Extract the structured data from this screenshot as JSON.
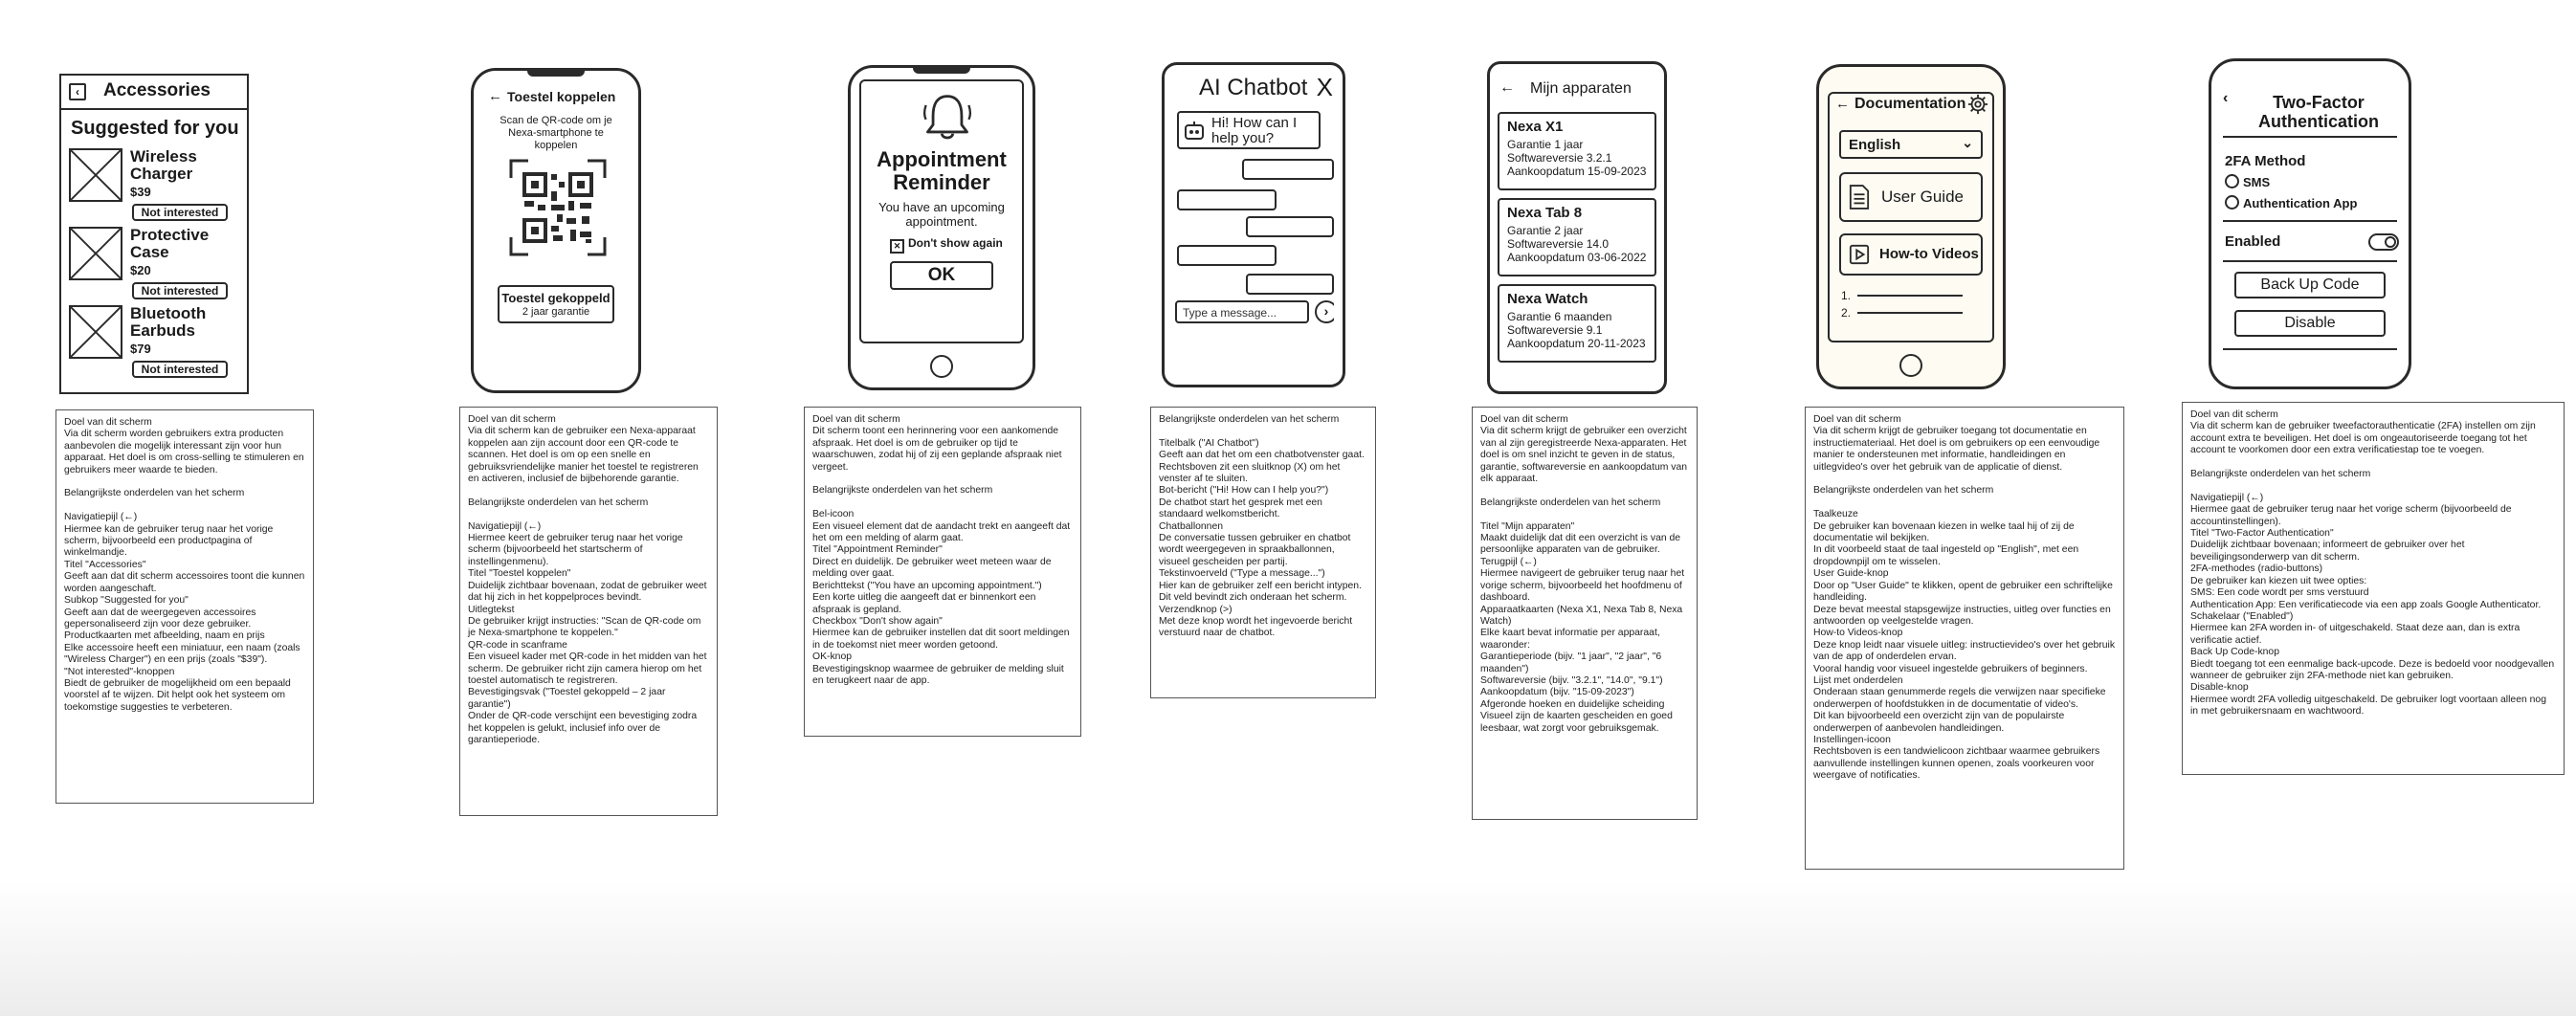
{
  "accessories": {
    "title": "Accessories",
    "subtitle": "Suggested for you",
    "not_interested": "Not interested",
    "products": [
      {
        "name1": "Wireless",
        "name2": "Charger",
        "price": "$39"
      },
      {
        "name1": "Protective",
        "name2": "Case",
        "price": "$20"
      },
      {
        "name1": "Bluetooth",
        "name2": "Earbuds",
        "price": "$79"
      }
    ],
    "desc": "Doel van dit scherm\nVia dit scherm worden gebruikers extra producten aanbevolen die mogelijk interessant zijn voor hun apparaat. Het doel is om cross-selling te stimuleren en gebruikers meer waarde te bieden.\n\nBelangrijkste onderdelen van het scherm\n\nNavigatiepijl (←)\nHiermee kan de gebruiker terug naar het vorige scherm, bijvoorbeeld een productpagina of winkelmandje.\nTitel \"Accessories\"\nGeeft aan dat dit scherm accessoires toont die kunnen worden aangeschaft.\nSubkop \"Suggested for you\"\nGeeft aan dat de weergegeven accessoires gepersonaliseerd zijn voor deze gebruiker.\nProductkaarten met afbeelding, naam en prijs\nElke accessoire heeft een miniatuur, een naam (zoals \"Wireless Charger\") en een prijs (zoals \"$39\").\n\"Not interested\"-knoppen\nBiedt de gebruiker de mogelijkheid om een bepaald voorstel af te wijzen. Dit helpt ook het systeem om toekomstige suggesties te verbeteren."
  },
  "pair": {
    "title": "Toestel koppelen",
    "instruction": "Scan de QR-code om je Nexa-smartphone te koppelen",
    "status_title": "Toestel gekoppeld",
    "status_sub": "2 jaar garantie",
    "desc": "Doel van dit scherm\nVia dit scherm kan de gebruiker een Nexa-apparaat koppelen aan zijn account door een QR-code te scannen. Het doel is om op een snelle en gebruiksvriendelijke manier het toestel te registreren en activeren, inclusief de bijbehorende garantie.\n\nBelangrijkste onderdelen van het scherm\n\nNavigatiepijl (←)\nHiermee keert de gebruiker terug naar het vorige scherm (bijvoorbeeld het startscherm of instellingenmenu).\nTitel \"Toestel koppelen\"\nDuidelijk zichtbaar bovenaan, zodat de gebruiker weet dat hij zich in het koppelproces bevindt.\nUitlegtekst\nDe gebruiker krijgt instructies: \"Scan de QR-code om je Nexa-smartphone te koppelen.\"\nQR-code in scanframe\nEen visueel kader met QR-code in het midden van het scherm. De gebruiker richt zijn camera hierop om het toestel automatisch te registreren.\nBevestigingsvak (\"Toestel gekoppeld – 2 jaar garantie\")\nOnder de QR-code verschijnt een bevestiging zodra het koppelen is gelukt, inclusief info over de garantieperiode."
  },
  "reminder": {
    "title1": "Appointment",
    "title2": "Reminder",
    "message": "You have an upcoming appointment.",
    "checkbox": "Don't show again",
    "ok": "OK",
    "desc": "Doel van dit scherm\nDit scherm toont een herinnering voor een aankomende afspraak. Het doel is om de gebruiker op tijd te waarschuwen, zodat hij of zij een geplande afspraak niet vergeet.\n\nBelangrijkste onderdelen van het scherm\n\nBel-icoon\nEen visueel element dat de aandacht trekt en aangeeft dat het om een melding of alarm gaat.\nTitel \"Appointment Reminder\"\nDirect en duidelijk. De gebruiker weet meteen waar de melding over gaat.\nBerichttekst (\"You have an upcoming appointment.\")\nEen korte uitleg die aangeeft dat er binnenkort een afspraak is gepland.\nCheckbox \"Don't show again\"\nHiermee kan de gebruiker instellen dat dit soort meldingen in de toekomst niet meer worden getoond.\nOK-knop\nBevestigingsknop waarmee de gebruiker de melding sluit en terugkeert naar de app."
  },
  "chatbot": {
    "title": "AI Chatbot",
    "close": "X",
    "greeting": "Hi! How can I help you?",
    "placeholder": "Type a message...",
    "desc": "Belangrijkste onderdelen van het scherm\n\nTitelbalk (\"AI Chatbot\")\nGeeft aan dat het om een chatbotvenster gaat. Rechtsboven zit een sluitknop (X) om het venster af te sluiten.\nBot-bericht (\"Hi! How can I help you?\")\nDe chatbot start het gesprek met een standaard welkomstbericht.\nChatballonnen\nDe conversatie tussen gebruiker en chatbot wordt weergegeven in spraakballonnen, visueel gescheiden per partij.\nTekstinvoerveld (\"Type a message...\")\nHier kan de gebruiker zelf een bericht intypen. Dit veld bevindt zich onderaan het scherm.\nVerzendknop (>)\nMet deze knop wordt het ingevoerde bericht verstuurd naar de chatbot."
  },
  "devices": {
    "title": "Mijn apparaten",
    "items": [
      {
        "name": "Nexa X1",
        "warranty": "Garantie 1 jaar",
        "software": "Softwareversie 3.2.1",
        "date": "Aankoopdatum 15-09-2023"
      },
      {
        "name": "Nexa Tab 8",
        "warranty": "Garantie 2 jaar",
        "software": "Softwareversie 14.0",
        "date": "Aankoopdatum 03-06-2022"
      },
      {
        "name": "Nexa Watch",
        "warranty": "Garantie 6 maanden",
        "software": "Softwareversie 9.1",
        "date": "Aankoopdatum 20-11-2023"
      }
    ],
    "desc": "Doel van dit scherm\nVia dit scherm krijgt de gebruiker een overzicht van al zijn geregistreerde Nexa-apparaten. Het doel is om snel inzicht te geven in de status, garantie, softwareversie en aankoopdatum van elk apparaat.\n\nBelangrijkste onderdelen van het scherm\n\nTitel \"Mijn apparaten\"\nMaakt duidelijk dat dit een overzicht is van de persoonlijke apparaten van de gebruiker.\nTerugpijl (←)\nHiermee navigeert de gebruiker terug naar het vorige scherm, bijvoorbeeld het hoofdmenu of dashboard.\nApparaatkaarten (Nexa X1, Nexa Tab 8, Nexa Watch)\nElke kaart bevat informatie per apparaat, waaronder:\nGarantieperiode (bijv. \"1 jaar\", \"2 jaar\", \"6 maanden\")\nSoftwareversie (bijv. \"3.2.1\", \"14.0\", \"9.1\")\nAankoopdatum (bijv. \"15-09-2023\")\nAfgeronde hoeken en duidelijke scheiding\nVisueel zijn de kaarten gescheiden en goed leesbaar, wat zorgt voor gebruiksgemak."
  },
  "docs": {
    "title": "Documentation",
    "language": "English",
    "user_guide": "User Guide",
    "videos": "How-to Videos",
    "list": [
      "1.",
      "2."
    ],
    "desc": "Doel van dit scherm\nVia dit scherm krijgt de gebruiker toegang tot documentatie en instructiemateriaal. Het doel is om gebruikers op een eenvoudige manier te ondersteunen met informatie, handleidingen en uitlegvideo's over het gebruik van de applicatie of dienst.\n\nBelangrijkste onderdelen van het scherm\n\nTaalkeuze\nDe gebruiker kan bovenaan kiezen in welke taal hij of zij de documentatie wil bekijken.\nIn dit voorbeeld staat de taal ingesteld op \"English\", met een dropdownpijl om te wisselen.\nUser Guide-knop\nDoor op \"User Guide\" te klikken, opent de gebruiker een schriftelijke handleiding.\nDeze bevat meestal stapsgewijze instructies, uitleg over functies en antwoorden op veelgestelde vragen.\nHow-to Videos-knop\nDeze knop leidt naar visuele uitleg: instructievideo's over het gebruik van de app of onderdelen ervan.\nVooral handig voor visueel ingestelde gebruikers of beginners.\nLijst met onderdelen\nOnderaan staan genummerde regels die verwijzen naar specifieke onderwerpen of hoofdstukken in de documentatie of video's.\nDit kan bijvoorbeeld een overzicht zijn van de populairste onderwerpen of aanbevolen handleidingen.\nInstellingen-icoon\nRechtsboven is een tandwielicoon zichtbaar waarmee gebruikers aanvullende instellingen kunnen openen, zoals voorkeuren voor weergave of notificaties."
  },
  "twofa": {
    "title1": "Two-Factor",
    "title2": "Authentication",
    "method_label": "2FA Method",
    "option_sms": "SMS",
    "option_app": "Authentication App",
    "enabled": "Enabled",
    "backup": "Back Up Code",
    "disable": "Disable",
    "desc": "Doel van dit scherm\nVia dit scherm kan de gebruiker tweefactorauthenticatie (2FA) instellen om zijn account extra te beveiligen. Het doel is om ongeautoriseerde toegang tot het account te voorkomen door een extra verificatiestap toe te voegen.\n\nBelangrijkste onderdelen van het scherm\n\nNavigatiepijl (←)\nHiermee gaat de gebruiker terug naar het vorige scherm (bijvoorbeeld de accountinstellingen).\nTitel \"Two-Factor Authentication\"\nDuidelijk zichtbaar bovenaan; informeert de gebruiker over het beveiligingsonderwerp van dit scherm.\n2FA-methodes (radio-buttons)\nDe gebruiker kan kiezen uit twee opties:\nSMS: Een code wordt per sms verstuurd\nAuthentication App: Een verificatiecode via een app zoals Google Authenticator.\nSchakelaar (\"Enabled\")\nHiermee kan 2FA worden in- of uitgeschakeld. Staat deze aan, dan is extra verificatie actief.\nBack Up Code-knop\nBiedt toegang tot een eenmalige back-upcode. Deze is bedoeld voor noodgevallen wanneer de gebruiker zijn 2FA-methode niet kan gebruiken.\nDisable-knop\nHiermee wordt 2FA volledig uitgeschakeld. De gebruiker logt voortaan alleen nog in met gebruikersnaam en wachtwoord."
  }
}
